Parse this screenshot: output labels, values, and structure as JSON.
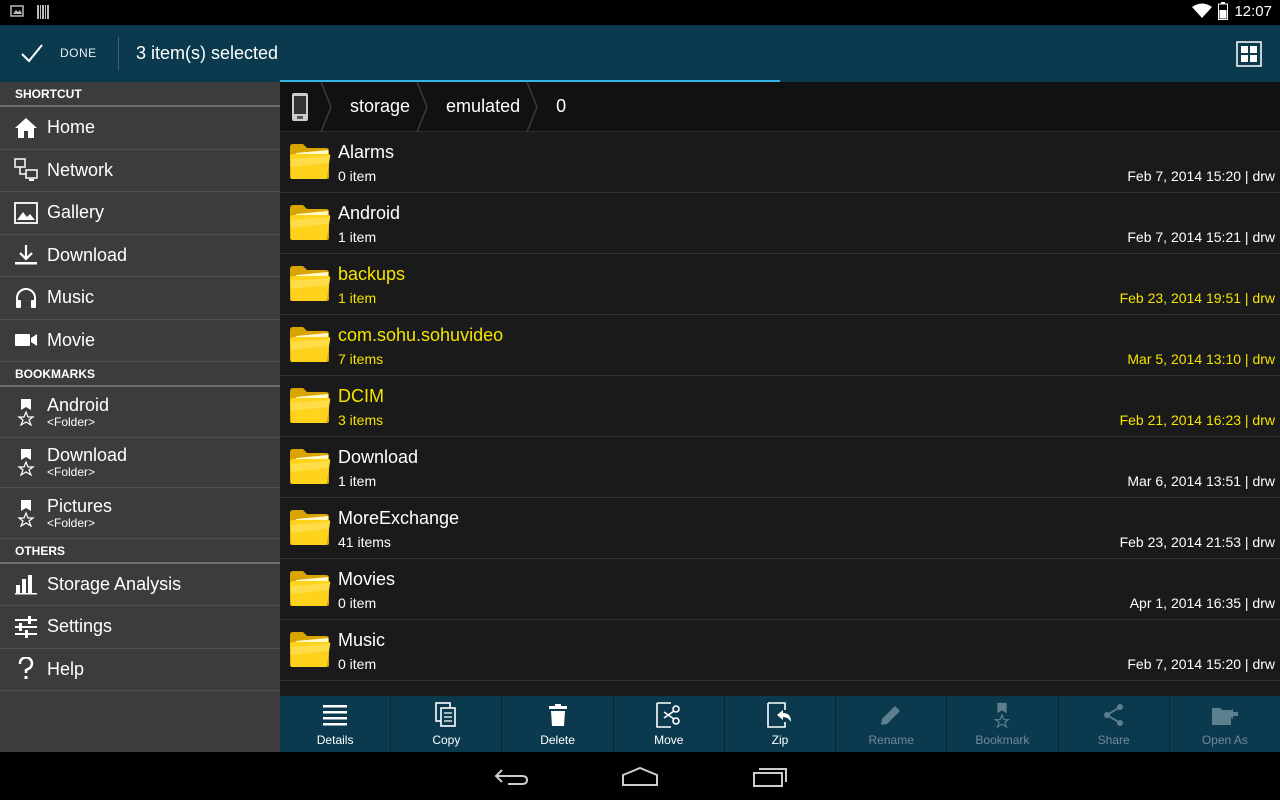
{
  "status_bar": {
    "time": "12:07",
    "icons": [
      "image-icon",
      "barcode-icon",
      "wifi-icon",
      "battery-icon"
    ]
  },
  "action_bar": {
    "done_label": "DONE",
    "title": "3 item(s) selected",
    "accent": "#0b3a4f",
    "progress_fraction": 0.5
  },
  "sidebar": {
    "shortcut_header": "SHORTCUT",
    "shortcuts": [
      {
        "label": "Home",
        "icon": "home-icon"
      },
      {
        "label": "Network",
        "icon": "network-icon"
      },
      {
        "label": "Gallery",
        "icon": "gallery-icon"
      },
      {
        "label": "Download",
        "icon": "download-icon"
      },
      {
        "label": "Music",
        "icon": "headphones-icon"
      },
      {
        "label": "Movie",
        "icon": "camera-icon"
      }
    ],
    "bookmarks_header": "BOOKMARKS",
    "bookmarks": [
      {
        "label": "Android",
        "sub": "<Folder>"
      },
      {
        "label": "Download",
        "sub": "<Folder>"
      },
      {
        "label": "Pictures",
        "sub": "<Folder>"
      }
    ],
    "others_header": "OTHERS",
    "others": [
      {
        "label": "Storage Analysis",
        "icon": "bar-chart-icon"
      },
      {
        "label": "Settings",
        "icon": "sliders-icon"
      },
      {
        "label": "Help",
        "icon": "question-icon"
      }
    ]
  },
  "breadcrumb": [
    "storage",
    "emulated",
    "0"
  ],
  "files": [
    {
      "name": "Alarms",
      "count": "0 item",
      "meta": "Feb 7, 2014 15:20 | drw",
      "selected": false
    },
    {
      "name": "Android",
      "count": "1 item",
      "meta": "Feb 7, 2014 15:21 | drw",
      "selected": false
    },
    {
      "name": "backups",
      "count": "1 item",
      "meta": "Feb 23, 2014 19:51 | drw",
      "selected": true
    },
    {
      "name": "com.sohu.sohuvideo",
      "count": "7 items",
      "meta": "Mar 5, 2014 13:10 | drw",
      "selected": true
    },
    {
      "name": "DCIM",
      "count": "3 items",
      "meta": "Feb 21, 2014 16:23 | drw",
      "selected": true
    },
    {
      "name": "Download",
      "count": "1 item",
      "meta": "Mar 6, 2014 13:51 | drw",
      "selected": false
    },
    {
      "name": "MoreExchange",
      "count": "41 items",
      "meta": "Feb 23, 2014 21:53 | drw",
      "selected": false
    },
    {
      "name": "Movies",
      "count": "0 item",
      "meta": "Apr 1, 2014 16:35 | drw",
      "selected": false
    },
    {
      "name": "Music",
      "count": "0 item",
      "meta": "Feb 7, 2014 15:20 | drw",
      "selected": false
    }
  ],
  "toolbar": [
    {
      "label": "Details",
      "icon": "details-icon",
      "enabled": true
    },
    {
      "label": "Copy",
      "icon": "copy-icon",
      "enabled": true
    },
    {
      "label": "Delete",
      "icon": "trash-icon",
      "enabled": true
    },
    {
      "label": "Move",
      "icon": "cut-icon",
      "enabled": true
    },
    {
      "label": "Zip",
      "icon": "zip-icon",
      "enabled": true
    },
    {
      "label": "Rename",
      "icon": "pencil-icon",
      "enabled": false
    },
    {
      "label": "Bookmark",
      "icon": "bookmark-icon",
      "enabled": false
    },
    {
      "label": "Share",
      "icon": "share-icon",
      "enabled": false
    },
    {
      "label": "Open As",
      "icon": "open-as-icon",
      "enabled": false
    }
  ],
  "colors": {
    "selected_text": "#f5e300",
    "sidebar_bg": "#3c3c3c",
    "list_bg": "#1a1a1a",
    "progress": "#33b5e5"
  }
}
